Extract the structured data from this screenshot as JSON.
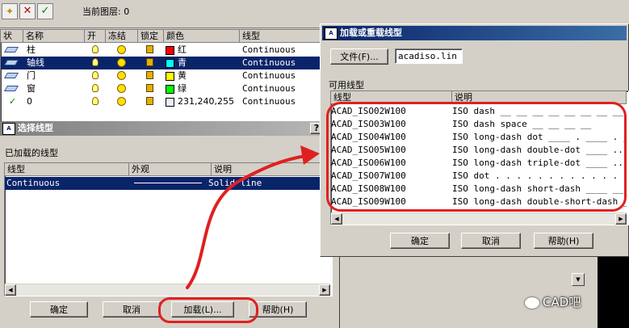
{
  "layer_panel": {
    "current_layer_label": "当前图层: 0",
    "headers": [
      "状",
      "名称",
      "开",
      "冻结",
      "锁定",
      "颜色",
      "线型"
    ],
    "rows": [
      {
        "name": "柱",
        "color_name": "红",
        "color": "#ff0000",
        "linetype": "Continuous",
        "selected": false
      },
      {
        "name": "轴线",
        "color_name": "青",
        "color": "#00ffff",
        "linetype": "Continuous",
        "selected": true
      },
      {
        "name": "门",
        "color_name": "黄",
        "color": "#ffff00",
        "linetype": "Continuous",
        "selected": false
      },
      {
        "name": "窗",
        "color_name": "绿",
        "color": "#00ff00",
        "linetype": "Continuous",
        "selected": false
      },
      {
        "name": "0",
        "color_name": "231,240,255",
        "color": "#e7f0ff",
        "linetype": "Continuous",
        "selected": false
      }
    ],
    "current_check": "✓"
  },
  "select_dialog": {
    "title": "选择线型",
    "icon_label": "A",
    "help_glyph": "?",
    "loaded_label": "已加载的线型",
    "headers": [
      "线型",
      "外观",
      "说明"
    ],
    "row": {
      "linetype": "Continuous",
      "description": "Solid line"
    },
    "buttons": {
      "ok": "确定",
      "cancel": "取消",
      "load": "加载(L)...",
      "help": "帮助(H)"
    }
  },
  "load_dialog": {
    "title": "加载或重载线型",
    "icon_label": "A",
    "file_button": "文件(F)...",
    "file_value": "acadiso.lin",
    "available_label": "可用线型",
    "headers": [
      "线型",
      "说明"
    ],
    "rows": [
      {
        "linetype": "ACAD_ISO02W100",
        "description": "ISO dash __ __ __ __ __ __ __ __"
      },
      {
        "linetype": "ACAD_ISO03W100",
        "description": "ISO dash space __    __    __    __"
      },
      {
        "linetype": "ACAD_ISO04W100",
        "description": "ISO long-dash dot ____ . ____ . ____"
      },
      {
        "linetype": "ACAD_ISO05W100",
        "description": "ISO long-dash double-dot ____ .. ____"
      },
      {
        "linetype": "ACAD_ISO06W100",
        "description": "ISO long-dash triple-dot ____ ... ___"
      },
      {
        "linetype": "ACAD_ISO07W100",
        "description": "ISO dot . . . . . . . . . . . . . ."
      },
      {
        "linetype": "ACAD_ISO08W100",
        "description": "ISO long-dash short-dash ____ __ ____"
      },
      {
        "linetype": "ACAD_ISO09W100",
        "description": "ISO long-dash double-short-dash ____"
      }
    ],
    "buttons": {
      "ok": "确定",
      "cancel": "取消",
      "help": "帮助(H)"
    }
  },
  "watermark": "CAD吧",
  "colors": {
    "annotation": "#e02020",
    "selection": "#0a246a"
  }
}
